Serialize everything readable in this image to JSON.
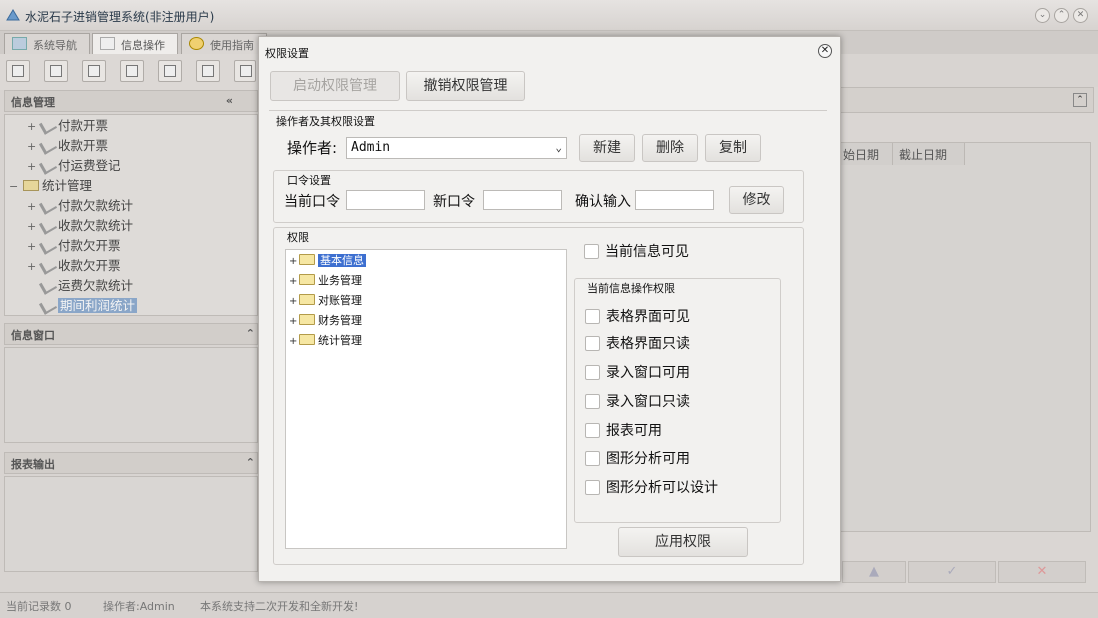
{
  "app": {
    "title": "水泥石子进销管理系统(非注册用户)"
  },
  "tabs": [
    {
      "label": "系统导航"
    },
    {
      "label": "信息操作"
    },
    {
      "label": "使用指南"
    }
  ],
  "left_panel": {
    "info_management_title": "信息管理",
    "tree_items": [
      {
        "label": "付款开票",
        "prefix": "+"
      },
      {
        "label": "收款开票",
        "prefix": "+"
      },
      {
        "label": "付运费登记",
        "prefix": "+"
      },
      {
        "label": "统计管理",
        "prefix": "−"
      },
      {
        "label": "付款欠款统计",
        "prefix": "+"
      },
      {
        "label": "收款欠款统计",
        "prefix": "+"
      },
      {
        "label": "付款欠开票",
        "prefix": "+"
      },
      {
        "label": "收款欠开票",
        "prefix": "+"
      },
      {
        "label": "运费欠款统计",
        "prefix": ""
      },
      {
        "label": "期间利润统计",
        "prefix": ""
      }
    ],
    "info_window_title": "信息窗口",
    "report_output_title": "报表输出"
  },
  "right_panel": {
    "columns": [
      "始日期",
      "截止日期"
    ],
    "buttons": [
      "▲",
      "✓",
      "✕"
    ]
  },
  "statusbar": {
    "record_count": "当前记录数 0",
    "operator": "操作者:Admin",
    "message": "本系统支持二次开发和全新开发!"
  },
  "dialog": {
    "title": "权限设置",
    "enable_button": "启动权限管理",
    "revoke_button": "撤销权限管理",
    "operator_group_label": "操作者及其权限设置",
    "operator_label": "操作者:",
    "operator_value": "Admin",
    "new_button": "新建",
    "delete_button": "删除",
    "copy_button": "复制",
    "password_group_label": "口令设置",
    "current_password_label": "当前口令",
    "new_password_label": "新口令",
    "confirm_label": "确认输入",
    "modify_button": "修改",
    "permission_group_label": "权限",
    "tree": [
      "基本信息",
      "业务管理",
      "对账管理",
      "财务管理",
      "统计管理"
    ],
    "current_visible_label": "当前信息可见",
    "ops_group_label": "当前信息操作权限",
    "checkboxes": [
      "表格界面可见",
      "表格界面只读",
      "录入窗口可用",
      "录入窗口只读",
      "报表可用",
      "图形分析可用",
      "图形分析可以设计"
    ],
    "apply_button": "应用权限"
  }
}
